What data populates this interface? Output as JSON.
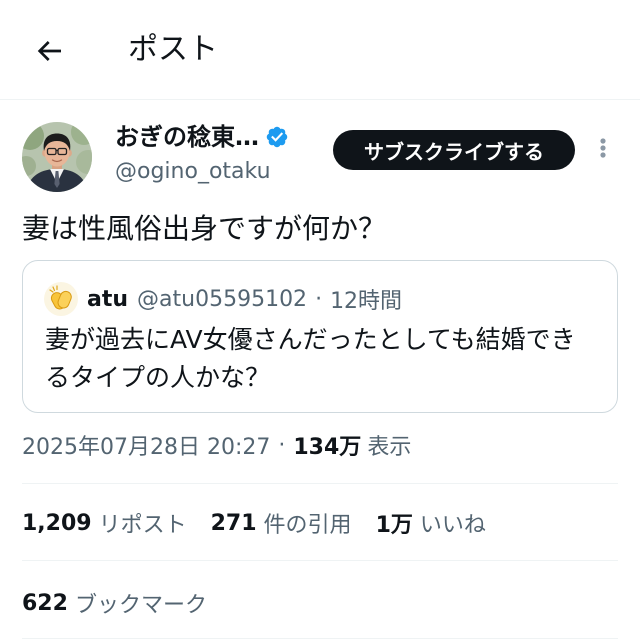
{
  "header": {
    "back_icon": "arrow-left-icon",
    "title": "ポスト"
  },
  "author": {
    "name": "おぎの稔東…",
    "handle": "@ogino_otaku",
    "verified_icon": "verified-badge-icon"
  },
  "actions": {
    "subscribe_label": "サブスクライブする",
    "more_icon": "more-vertical-icon"
  },
  "post": {
    "text": "妻は性風俗出身ですが何か？"
  },
  "quote": {
    "avatar_icon": "clapping-hands-icon",
    "name": "atu",
    "handle": "@atu05595102",
    "separator": "·",
    "time": "12時間",
    "text": "妻が過去にAV女優さんだったとしても結婚できるタイプの人かな？"
  },
  "meta": {
    "timestamp": "2025年07月28日 20:27",
    "separator": "·",
    "views_count": "134万",
    "views_label": "表示"
  },
  "stats": [
    {
      "count": "1,209",
      "label": "リポスト"
    },
    {
      "count": "271",
      "label": "件の引用"
    },
    {
      "count": "1万",
      "label": "いいね"
    }
  ],
  "bookmarks": {
    "count": "622",
    "label": "ブックマーク"
  },
  "colors": {
    "text": "#0f1419",
    "secondary": "#536471",
    "accent": "#1d9bf0",
    "border": "#cfd9de",
    "button_bg": "#0f1419",
    "button_text": "#ffffff"
  }
}
